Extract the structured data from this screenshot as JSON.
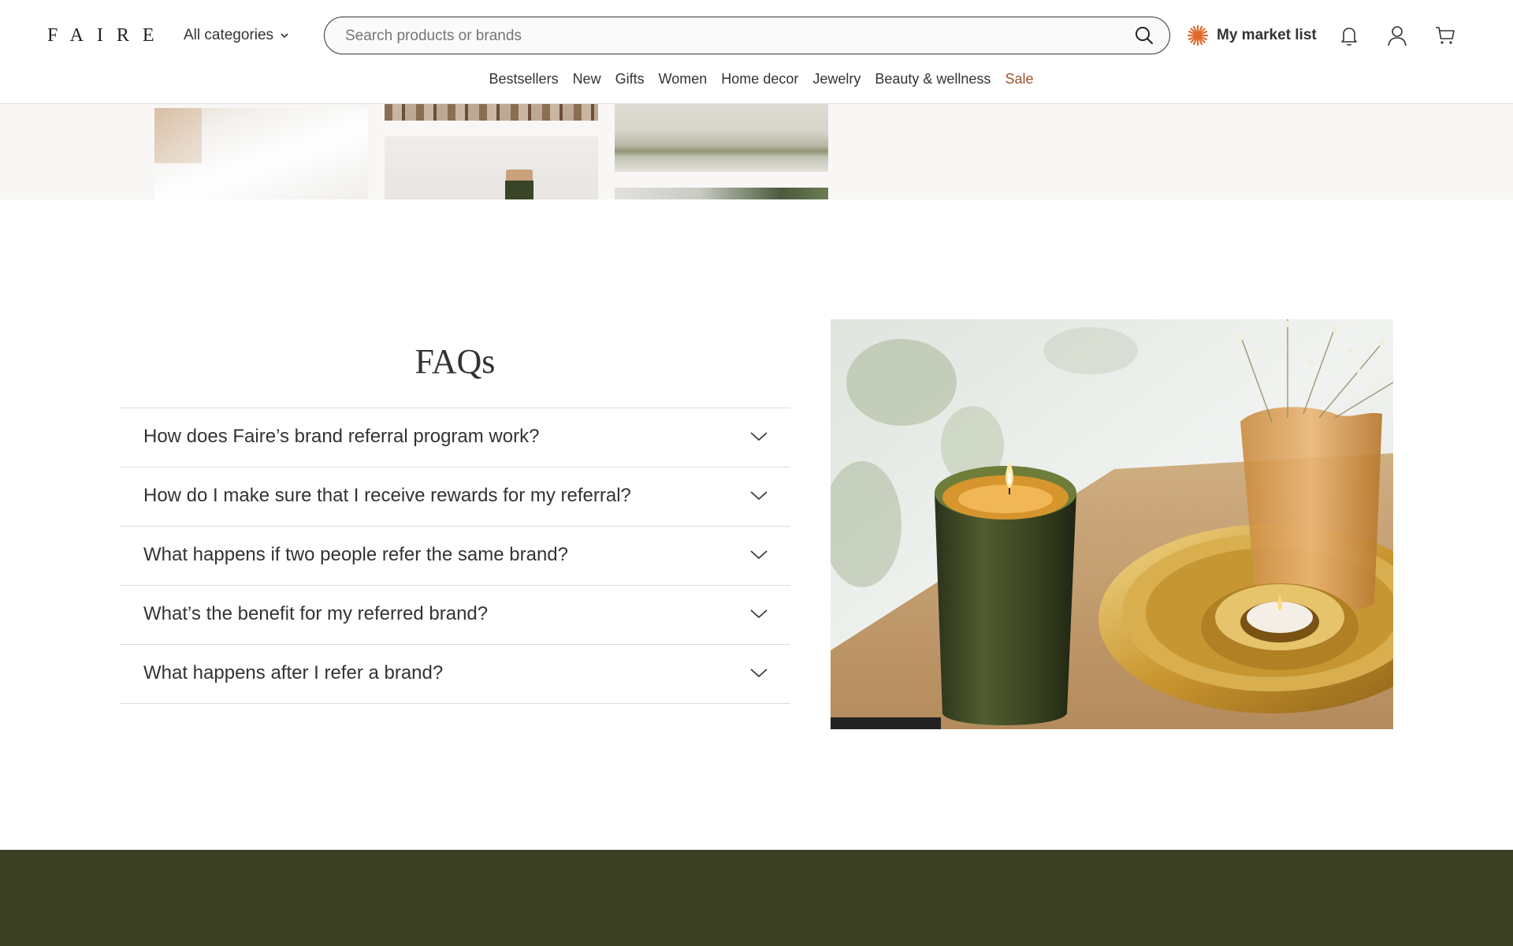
{
  "header": {
    "logo": "FAIRE",
    "categories_label": "All categories",
    "search_placeholder": "Search products or brands",
    "market_list_label": "My market list",
    "accent_color": "#e06a2c"
  },
  "nav": {
    "items": [
      "Bestsellers",
      "New",
      "Gifts",
      "Women",
      "Home decor",
      "Jewelry",
      "Beauty & wellness",
      "Sale"
    ],
    "sale_color": "#a0522d"
  },
  "faq": {
    "title": "FAQs",
    "questions": [
      "How does Faire’s brand referral program work?",
      "How do I make sure that I receive rewards for my referral?",
      "What happens if two people refer the same brand?",
      "What’s the benefit for my referred brand?",
      "What happens after I refer a brand?"
    ]
  },
  "footer": {
    "background": "#3b3f24"
  }
}
